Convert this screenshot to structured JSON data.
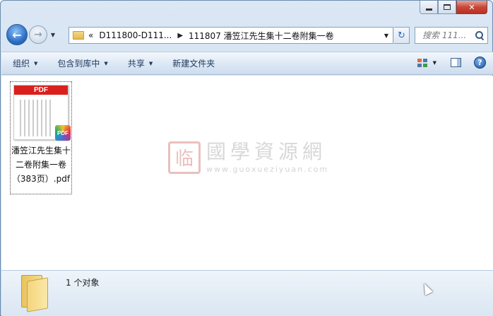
{
  "window": {
    "caption": {
      "close_glyph": "✕"
    }
  },
  "nav": {
    "back_glyph": "←",
    "forward_glyph": "→",
    "history_glyph": "▼"
  },
  "address": {
    "overflow_glyph": "«",
    "crumbs": [
      "D111800-D111...",
      "111807 潘笠江先生集十二卷附集一卷"
    ],
    "separator_glyph": "▶",
    "dropdown_glyph": "▼",
    "refresh_glyph": "↻"
  },
  "search": {
    "placeholder": "搜索 111..."
  },
  "toolbar": {
    "organize": "组织",
    "include_in_library": "包含到库中",
    "share": "共享",
    "new_folder": "新建文件夹",
    "arrow_glyph": "▼",
    "help_glyph": "?"
  },
  "files": [
    {
      "thumb_banner": "PDF",
      "badge": "PDF",
      "name": "潘笠江先生集十二卷附集一卷（383页）.pdf"
    }
  ],
  "watermark": {
    "seal": "临",
    "title": "國學資源網",
    "url": "www.guoxueziyuan.com"
  },
  "details": {
    "count_text": "1 个对象"
  },
  "colors": {
    "pdf_red": "#d9201d",
    "toolbar_text": "#1e395b",
    "close_red": "#c8473a"
  }
}
